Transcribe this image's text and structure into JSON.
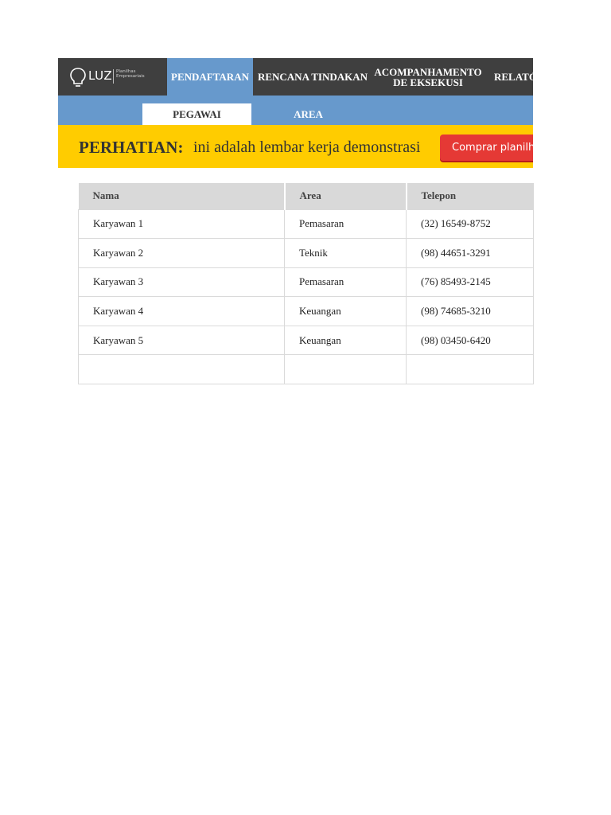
{
  "logo": {
    "name": "LUZ",
    "subtitle": "Planilhas Empresariais"
  },
  "nav": {
    "items": [
      {
        "label": "PENDAFTARAN"
      },
      {
        "label": "RENCANA TINDAKAN"
      },
      {
        "label_line1": "ACOMPANHAMENTO",
        "label_line2": "DE EKSEKUSI"
      },
      {
        "label": "RELATÓRIOS"
      }
    ]
  },
  "subnav": {
    "tabs": [
      {
        "label": "PEGAWAI"
      },
      {
        "label": "AREA"
      }
    ]
  },
  "banner": {
    "bold": "PERHATIAN:",
    "text": "ini adalah lembar kerja demonstrasi",
    "button_label": "Comprar planilha"
  },
  "table": {
    "headers": [
      "Nama",
      "Area",
      "Telepon"
    ],
    "rows": [
      [
        "Karyawan 1",
        "Pemasaran",
        "(32) 16549-8752"
      ],
      [
        "Karyawan 2",
        "Teknik",
        "(98) 44651-3291"
      ],
      [
        "Karyawan 3",
        "Pemasaran",
        "(76) 85493-2145"
      ],
      [
        "Karyawan 4",
        "Keuangan",
        "(98) 74685-3210"
      ],
      [
        "Karyawan 5",
        "Keuangan",
        "(98) 03450-6420"
      ],
      [
        "",
        "",
        ""
      ]
    ]
  },
  "colors": {
    "dark": "#3f3f3f",
    "blue": "#6799cc",
    "yellow": "#ffcc00",
    "red": "#e53935"
  }
}
